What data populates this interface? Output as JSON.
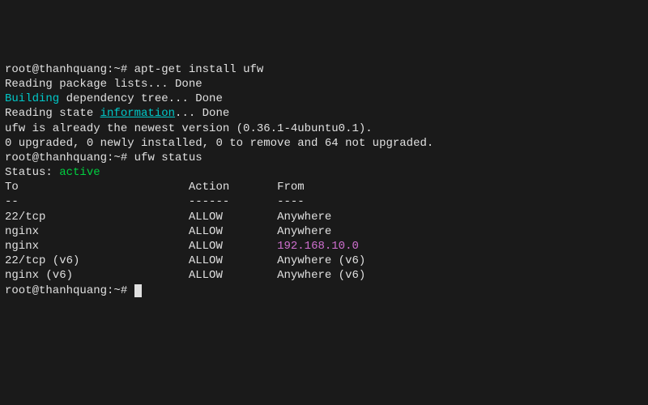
{
  "prompt": "root@thanhquang:~# ",
  "cmd1": "apt-get install ufw",
  "out_reading": "Reading package lists... Done",
  "out_building_word": "Building",
  "out_building_rest": " dependency tree... Done",
  "out_state1": "Reading state ",
  "out_state_info": "information",
  "out_state2": "... Done",
  "out_newest": "ufw is already the newest version (0.36.1-4ubuntu0.1).",
  "out_upgraded": "0 upgraded, 0 newly installed, 0 to remove and 64 not upgraded.",
  "cmd2": "ufw status",
  "status_label": "Status: ",
  "status_value": "active",
  "header": {
    "to": "To",
    "action": "Action",
    "from": "From",
    "to_uline": "--",
    "action_uline": "------",
    "from_uline": "----"
  },
  "rules": [
    {
      "to": "22/tcp",
      "action": "ALLOW",
      "from": "Anywhere",
      "from_color": "normal"
    },
    {
      "to": "nginx",
      "action": "ALLOW",
      "from": "Anywhere",
      "from_color": "normal"
    },
    {
      "to": "nginx",
      "action": "ALLOW",
      "from": "192.168.10.0",
      "from_color": "magenta"
    },
    {
      "to": "22/tcp (v6)",
      "action": "ALLOW",
      "from": "Anywhere (v6)",
      "from_color": "normal"
    },
    {
      "to": "nginx (v6)",
      "action": "ALLOW",
      "from": "Anywhere (v6)",
      "from_color": "normal"
    }
  ]
}
